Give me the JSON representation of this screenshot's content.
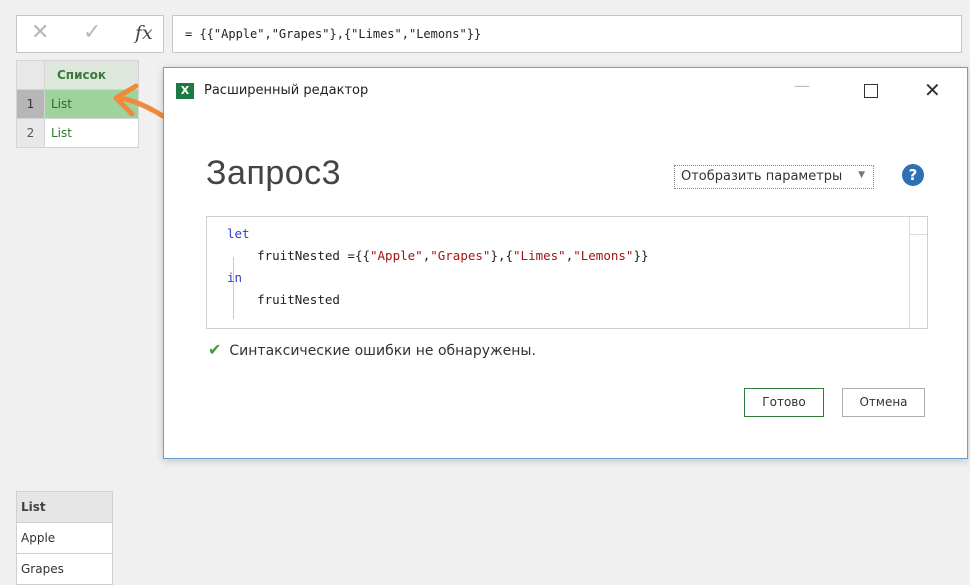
{
  "formula_bar": {
    "cancel_icon": "close-icon",
    "confirm_icon": "check-icon",
    "fx_label": "fx",
    "formula": "= {{\"Apple\",\"Grapes\"},{\"Limes\",\"Lemons\"}}"
  },
  "list_grid": {
    "header": "Список",
    "rows": [
      {
        "num": "1",
        "value": "List"
      },
      {
        "num": "2",
        "value": "List"
      }
    ]
  },
  "dialog": {
    "title": "Расширенный редактор",
    "app_icon_letter": "X",
    "query_name": "Запрос3",
    "params_label": "Отобразить параметры",
    "help_label": "?",
    "code": {
      "line1_kw": "let",
      "line2_pre": "fruitNested ={{",
      "s1": "\"Apple\"",
      "comma1": ",",
      "s2": "\"Grapes\"",
      "mid": "},{",
      "s3": "\"Limes\"",
      "comma2": ",",
      "s4": "\"Lemons\"",
      "end": "}}",
      "line3_kw": "in",
      "line4": "fruitNested"
    },
    "syntax_message": "Синтаксические ошибки не обнаружены.",
    "ok_label": "Готово",
    "cancel_label": "Отмена"
  },
  "bottom_list": {
    "header": "List",
    "items": [
      "Apple",
      "Grapes"
    ]
  },
  "colors": {
    "arrow": "#f08a3a",
    "selected_row": "#9ed39e",
    "excel_green": "#1e7a45",
    "help_blue": "#2f6fb4"
  }
}
